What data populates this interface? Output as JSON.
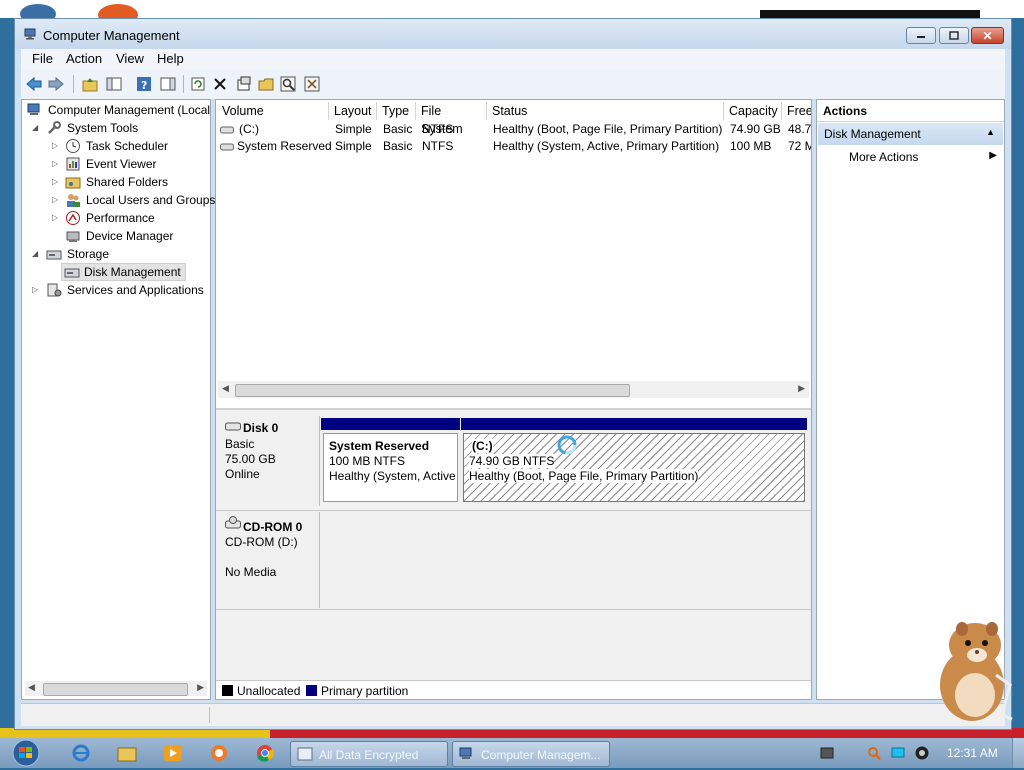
{
  "window": {
    "title": "Computer Management"
  },
  "menu": [
    "File",
    "Action",
    "View",
    "Help"
  ],
  "tree": {
    "root": "Computer Management (Local",
    "system_tools": "System Tools",
    "task_scheduler": "Task Scheduler",
    "event_viewer": "Event Viewer",
    "shared_folders": "Shared Folders",
    "local_users": "Local Users and Groups",
    "performance": "Performance",
    "device_manager": "Device Manager",
    "storage": "Storage",
    "disk_management": "Disk Management",
    "services": "Services and Applications"
  },
  "volume_list": {
    "columns": [
      "Volume",
      "Layout",
      "Type",
      "File System",
      "Status",
      "Capacity",
      "Free"
    ],
    "rows": [
      {
        "volume": "(C:)",
        "layout": "Simple",
        "type": "Basic",
        "fs": "NTFS",
        "status": "Healthy (Boot, Page File, Primary Partition)",
        "capacity": "74.90 GB",
        "free": "48.72"
      },
      {
        "volume": "System Reserved",
        "layout": "Simple",
        "type": "Basic",
        "fs": "NTFS",
        "status": "Healthy (System, Active, Primary Partition)",
        "capacity": "100 MB",
        "free": "72 M"
      }
    ]
  },
  "disks": {
    "disk0": {
      "name": "Disk 0",
      "type": "Basic",
      "size": "75.00 GB",
      "state": "Online"
    },
    "cdrom0": {
      "name": "CD-ROM 0",
      "drive": "CD-ROM (D:)",
      "media": "No Media"
    },
    "part_reserved": {
      "name": "System Reserved",
      "size": "100 MB NTFS",
      "status": "Healthy (System, Active"
    },
    "part_c": {
      "name": "(C:)",
      "size": "74.90 GB NTFS",
      "status": "Healthy (Boot, Page File, Primary Partition)"
    }
  },
  "legend": {
    "unallocated": "Unallocated",
    "primary": "Primary partition"
  },
  "actions": {
    "header": "Actions",
    "section": "Disk Management",
    "more": "More Actions"
  },
  "taskbar": {
    "btn1": "All Data Encrypted",
    "btn2": "Computer Managem...",
    "clock": "12:31 AM"
  },
  "colors": {
    "primary_partition": "#000080",
    "unallocated": "#000000",
    "selection": "#cfe0f2"
  }
}
